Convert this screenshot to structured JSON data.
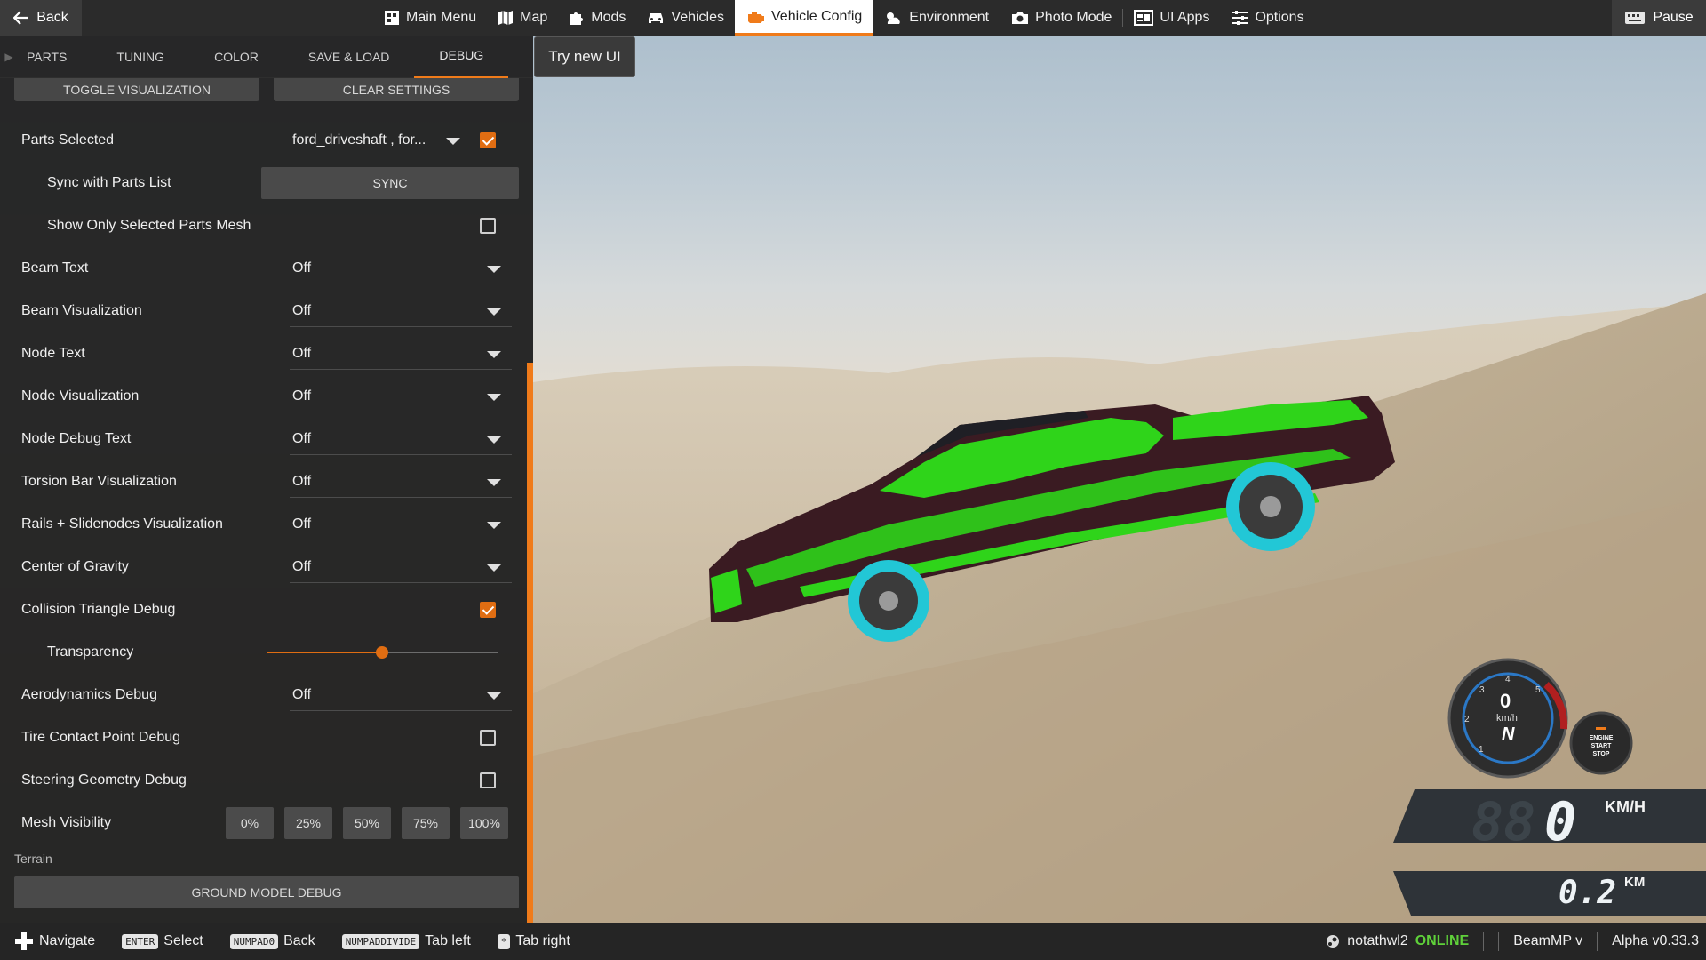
{
  "topbar": {
    "back_label": "Back",
    "nav": [
      {
        "label": "Main Menu",
        "icon": "main-menu-icon"
      },
      {
        "label": "Map",
        "icon": "map-icon"
      },
      {
        "label": "Mods",
        "icon": "puzzle-icon"
      },
      {
        "label": "Vehicles",
        "icon": "car-icon"
      },
      {
        "label": "Vehicle Config",
        "icon": "engine-icon",
        "active": true
      },
      {
        "label": "Environment",
        "icon": "weather-icon"
      },
      {
        "label": "Photo Mode",
        "icon": "camera-icon"
      },
      {
        "label": "UI Apps",
        "icon": "ui-apps-icon"
      },
      {
        "label": "Options",
        "icon": "sliders-icon"
      }
    ],
    "pause_label": "Pause"
  },
  "tabs": [
    "PARTS",
    "TUNING",
    "COLOR",
    "SAVE & LOAD",
    "DEBUG"
  ],
  "active_tab": "DEBUG",
  "try_new_ui": "Try new UI",
  "top_buttons": {
    "toggle": "TOGGLE VISUALIZATION",
    "clear": "CLEAR SETTINGS"
  },
  "rows": {
    "parts_selected": {
      "label": "Parts Selected",
      "value": "ford_driveshaft , for...",
      "checked": true
    },
    "sync": {
      "label": "Sync with Parts List",
      "button": "SYNC"
    },
    "show_only_mesh": {
      "label": "Show Only Selected Parts Mesh",
      "checked": false
    },
    "beam_text": {
      "label": "Beam Text",
      "value": "Off"
    },
    "beam_vis": {
      "label": "Beam Visualization",
      "value": "Off"
    },
    "node_text": {
      "label": "Node Text",
      "value": "Off"
    },
    "node_vis": {
      "label": "Node Visualization",
      "value": "Off"
    },
    "node_debug_text": {
      "label": "Node Debug Text",
      "value": "Off"
    },
    "torsion_bar": {
      "label": "Torsion Bar Visualization",
      "value": "Off"
    },
    "rails": {
      "label": "Rails + Slidenodes Visualization",
      "value": "Off"
    },
    "cog": {
      "label": "Center of Gravity",
      "value": "Off"
    },
    "collision_tri": {
      "label": "Collision Triangle Debug",
      "checked": true
    },
    "transparency": {
      "label": "Transparency",
      "value_fraction": 0.5
    },
    "aero": {
      "label": "Aerodynamics Debug",
      "value": "Off"
    },
    "tire_contact": {
      "label": "Tire Contact Point Debug",
      "checked": false
    },
    "steering_geo": {
      "label": "Steering Geometry Debug",
      "checked": false
    },
    "mesh_visibility": {
      "label": "Mesh Visibility",
      "options": [
        "0%",
        "25%",
        "50%",
        "75%",
        "100%"
      ]
    }
  },
  "terrain": {
    "section_label": "Terrain",
    "ground_button": "GROUND MODEL DEBUG"
  },
  "hud": {
    "speed": "0",
    "speed_ghost": "88",
    "speed_unit": "KM/H",
    "distance": "0.2",
    "distance_unit": "KM",
    "gauge_center": "0",
    "gauge_unit": "km/h",
    "gauge_gear": "N",
    "gauge_ticks": [
      "1",
      "2",
      "3",
      "4",
      "5"
    ],
    "engine_button": [
      "ENGINE",
      "START",
      "STOP"
    ]
  },
  "bottombar": {
    "hints": [
      {
        "key": "",
        "icon": "dpad-icon",
        "label": "Navigate"
      },
      {
        "key": "ENTER",
        "label": "Select"
      },
      {
        "key": "NUMPAD0",
        "label": "Back"
      },
      {
        "key": "NUMPADDIVIDE",
        "label": "Tab left"
      },
      {
        "key": "*",
        "label": "Tab right"
      }
    ],
    "username": "notathwl2",
    "status": "ONLINE",
    "mod": "BeamMP v",
    "version": "Alpha v0.33.3"
  },
  "colors": {
    "accent": "#f07b1a",
    "online": "#5fd13a",
    "car_body": "#3a1b22",
    "debug_mesh": "#2fd41a",
    "wheel_highlight": "#22c7d6"
  }
}
